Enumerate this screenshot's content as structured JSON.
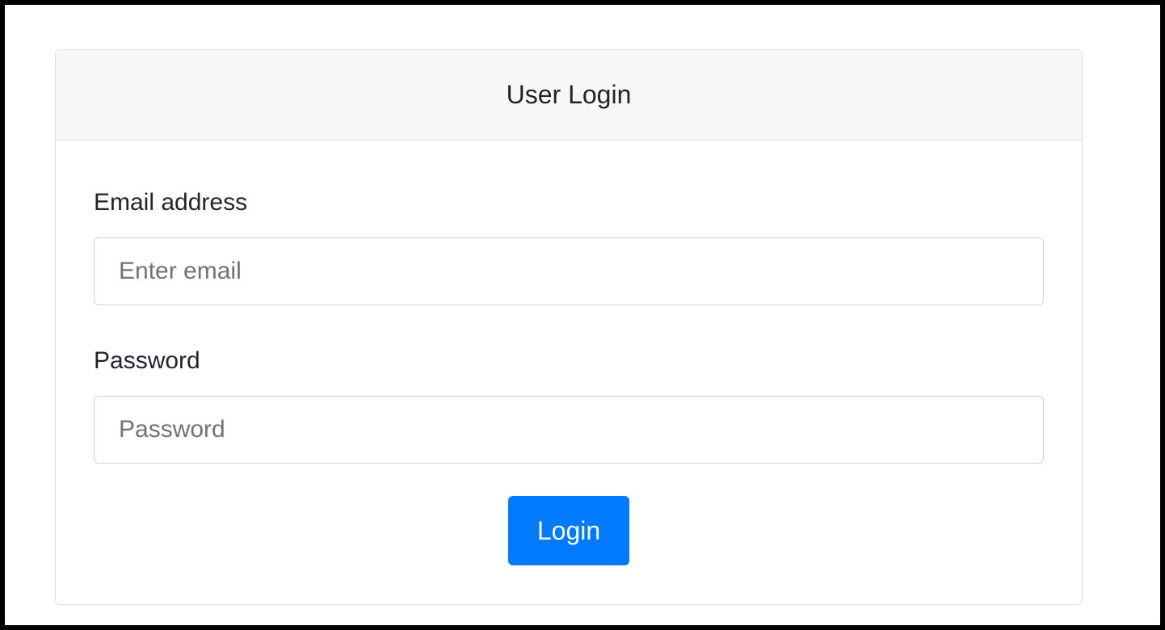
{
  "card": {
    "title": "User Login"
  },
  "form": {
    "email": {
      "label": "Email address",
      "value": "",
      "placeholder": "Enter email"
    },
    "password": {
      "label": "Password",
      "value": "",
      "placeholder": "Password"
    },
    "submit_label": "Login"
  },
  "colors": {
    "background": "#000000",
    "card_header": "#f7f7f7",
    "primary_button": "#007bff"
  }
}
